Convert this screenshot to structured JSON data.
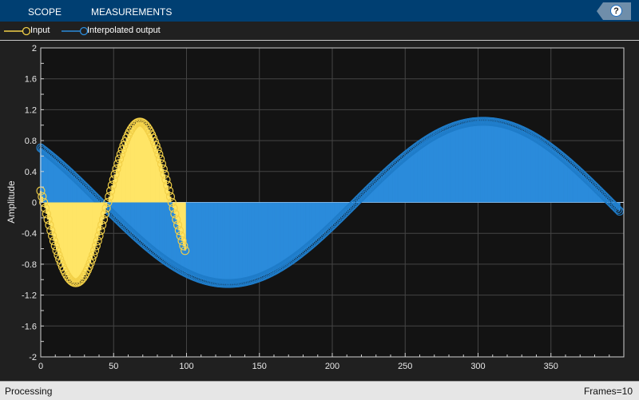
{
  "toolstrip": {
    "tabs": [
      "SCOPE",
      "MEASUREMENTS"
    ],
    "help_label": "?"
  },
  "legend": {
    "items": [
      "Input",
      "Interpolated output"
    ]
  },
  "status": {
    "left": "Processing",
    "right": "Frames=10"
  },
  "colors": {
    "input": "#ffe566",
    "input_marker": "#f2d048",
    "output": "#2a8bdb",
    "axes_bg": "#131313",
    "grid": "#444444"
  },
  "chart_data": {
    "type": "stem",
    "title": "",
    "xlabel": "",
    "ylabel": "Amplitude",
    "xlim": [
      0,
      400
    ],
    "ylim": [
      -2,
      2
    ],
    "xticks": [
      0,
      50,
      100,
      150,
      200,
      250,
      300,
      350
    ],
    "xtick_labels": [
      "0",
      "50",
      "100",
      "150",
      "200",
      "250",
      "300",
      "350"
    ],
    "yticks": [
      2,
      1.6,
      1.2,
      0.8,
      0.4,
      0,
      -0.4,
      -0.8,
      -1.2,
      -1.6,
      -2
    ],
    "ytick_labels": [
      "2",
      "1.6",
      "1.2",
      "0.8",
      "0.4",
      "0",
      "-0.4",
      "-0.8",
      "-1.2",
      "-1.6",
      "-2"
    ],
    "grid": true,
    "legend_position": "top-left",
    "series": [
      {
        "name": "Input",
        "marker": "circle",
        "samples": 100,
        "x_start": 0,
        "x_end": 99,
        "model": {
          "shape": "sine",
          "amplitude": 1.04,
          "period": 88,
          "rising_zero_crossing": 46
        },
        "key_values": {
          "x0": 0.15,
          "min": -1.04,
          "min_at": 24,
          "max": 1.04,
          "max_at": 68,
          "last": -0.6
        }
      },
      {
        "name": "Interpolated output",
        "marker": "circle",
        "samples": 398,
        "x_start": 0,
        "x_end": 397,
        "model": {
          "shape": "sine",
          "amplitude": -1.05,
          "period": 350,
          "falling_zero_crossing": 41
        },
        "key_values": {
          "x0": 0.68,
          "min": -1.05,
          "min_at": 128,
          "max": 1.05,
          "max_at": 303,
          "last": -0.1
        }
      }
    ]
  }
}
